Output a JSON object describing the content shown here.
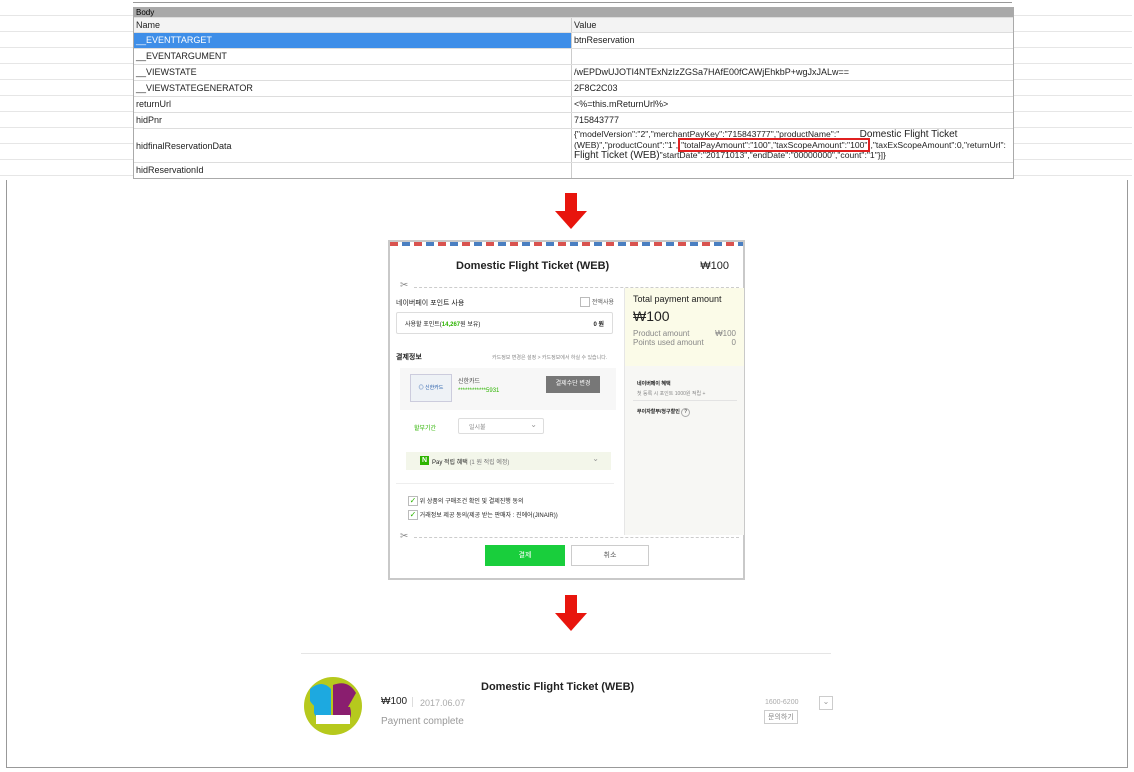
{
  "table": {
    "title": "Body",
    "col_name": "Name",
    "col_value": "Value",
    "rows": [
      {
        "name": "__EVENTTARGET",
        "value": "btnReservation"
      },
      {
        "name": "__EVENTARGUMENT",
        "value": ""
      },
      {
        "name": "__VIEWSTATE",
        "value": "/wEPDwUJOTI4NTExNzIzZGSa7HAfE00fCAWjEhkbP+wgJxJALw=="
      },
      {
        "name": "__VIEWSTATEGENERATOR",
        "value": "2F8C2C03"
      },
      {
        "name": "returnUrl",
        "value": "<%=this.mReturnUrl%>"
      },
      {
        "name": "hidPnr",
        "value": "715843777"
      },
      {
        "name": "hidfinalReservationData",
        "value_line1": "{\"modelVersion\":\"2\",\"merchantPayKey\":\"715843777\",\"productName\":\"",
        "overlay1": "Domestic Flight Ticket",
        "value_line2a": "(WEB)\",\"productCount\":\"1\",",
        "highlight": "\"totalPayAmount\":\"100\",\"taxScopeAmount\":\"100\"",
        "value_line2b": ",\"taxExScopeAmount\":0,\"returnUrl\":",
        "overlay2": "Flight Ticket (WEB)",
        "value_line3": "\"startDate\":\"20171013\",\"endDate\":\"00000000\",\"count\":\"1\"}]}"
      },
      {
        "name": "hidReservationId",
        "value": ""
      }
    ]
  },
  "payment": {
    "title": "Domestic Flight Ticket (WEB)",
    "price": "₩100",
    "points_section": "네이버페이 포인트 사용",
    "use_all": "전액사용",
    "points_label": "사용할 포인트(",
    "points_value": "14,267",
    "points_suffix": "원 보유)",
    "points_input": "0 원",
    "pay_info": "결제정보",
    "pay_info_note": "카드정보 변경은 설정 > 카드정보에서 하실 수 있습니다.",
    "card_logo": "◎ 신한카드",
    "card_name": "신한카드",
    "card_number": "************5931",
    "change_method": "결제수단 변경",
    "installment_label": "할부기간",
    "installment_value": "일시불",
    "npay_badge": "N",
    "npay_label": "Pay 적립 혜택",
    "npay_detail": "(1 원 적립 예정)",
    "agree1": "위 상품의 구매조건 확인 및 결제진행 동의",
    "agree2": "거래정보 제공 동의(제공 받는 판매자 : 진에어(JINAIR))",
    "total_label": "Total payment amount",
    "total_value": "₩100",
    "product_amount_label": "Product amount",
    "product_amount_value": "₩100",
    "points_used_label": "Points used amount",
    "points_used_value": "0",
    "benefit_title": "네이버페이 혜택",
    "benefit_detail": "첫 등록 시 포인트 1000원 적립 +",
    "free_install": "무이자할부/청구할인",
    "help_icon": "?",
    "pay_button": "결제",
    "cancel_button": "취소"
  },
  "result": {
    "title": "Domestic Flight Ticket (WEB)",
    "price": "₩100",
    "date": "2017.06.07",
    "status": "Payment complete",
    "phone": "1600-6200",
    "inquiry": "문의하기"
  },
  "colors": {
    "arrow": "#e8150d",
    "highlight": "#e02020",
    "selected_row": "#3e8ee8",
    "pay_green": "#19ce3c"
  }
}
